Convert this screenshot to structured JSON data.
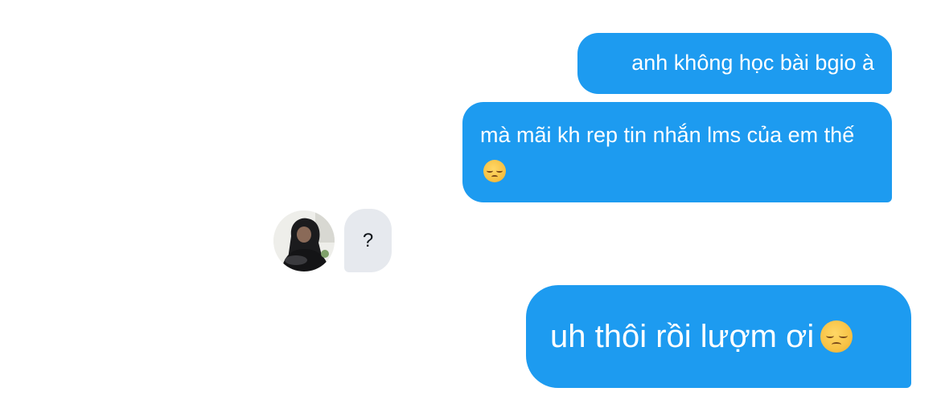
{
  "conversation": {
    "messages": [
      {
        "sender": "me",
        "text": "anh không học bài bgio à"
      },
      {
        "sender": "me",
        "text": "mà mãi kh rep tin nhắn lms của em thế",
        "emoji": "pensive-face"
      },
      {
        "sender": "other",
        "text": "?"
      },
      {
        "sender": "me",
        "text": "uh thôi rồi lượm ơi",
        "emoji": "pensive-face"
      }
    ]
  },
  "colors": {
    "sent_bubble": "#1d9bf0",
    "received_bubble": "#e6e9ee",
    "background": "#ffffff"
  },
  "icons": {
    "emoji": "pensive-face",
    "avatar": "user-avatar"
  }
}
